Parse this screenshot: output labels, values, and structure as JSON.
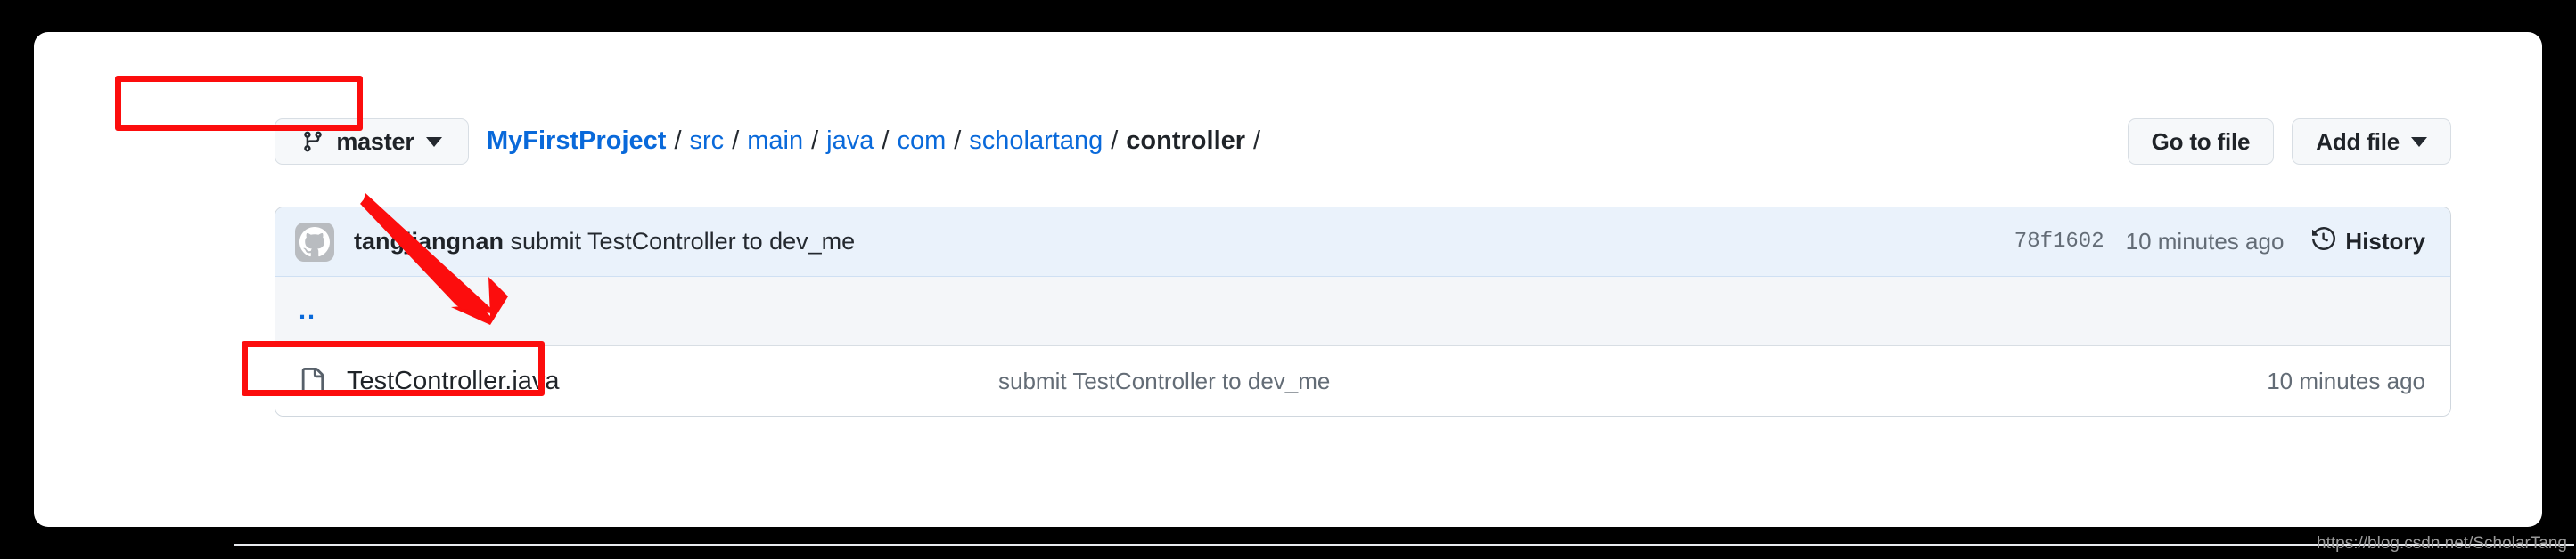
{
  "branch": {
    "name": "master",
    "icon": "git-branch-icon",
    "caret_icon": "chevron-down-icon"
  },
  "breadcrumb": {
    "separator": "/",
    "items": [
      {
        "label": "MyFirstProject",
        "type": "root-link"
      },
      {
        "label": "src",
        "type": "link"
      },
      {
        "label": "main",
        "type": "link"
      },
      {
        "label": "java",
        "type": "link"
      },
      {
        "label": "com",
        "type": "link"
      },
      {
        "label": "scholartang",
        "type": "link"
      },
      {
        "label": "controller",
        "type": "current"
      }
    ],
    "trailing_separator": "/"
  },
  "header_buttons": {
    "go_to_file": "Go to file",
    "add_file": "Add file"
  },
  "commit_bar": {
    "avatar_icon": "github-octocat-avatar",
    "author": "tangjiangnan",
    "message": "submit TestController to dev_me",
    "sha": "78f1602",
    "relative_time": "10 minutes ago",
    "history_label": "History",
    "history_icon": "clock-history-icon"
  },
  "file_rows": [
    {
      "name": "..",
      "kind": "parent-directory",
      "message": "",
      "time": ""
    },
    {
      "name": "TestController.java",
      "kind": "file",
      "icon": "file-icon",
      "message": "submit TestController to dev_me",
      "time": "10 minutes ago"
    }
  ],
  "annotations": {
    "branch_box": "red-highlight-box",
    "file_box": "red-highlight-box",
    "arrow": "red-arrow-pointing-to-file"
  },
  "watermark": "https://blog.csdn.net/ScholarTang",
  "colors": {
    "link_blue": "#0969da",
    "annotation_red": "#fc0d0d",
    "commit_bar_bg": "#eaf2fb",
    "updir_row_bg": "#f4f6f9",
    "border": "#d0d7de",
    "muted_text": "#636c76"
  }
}
